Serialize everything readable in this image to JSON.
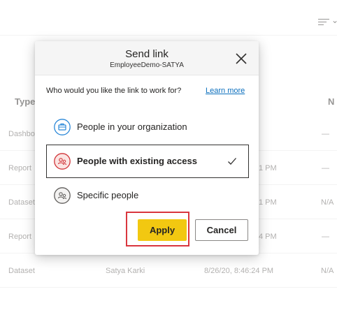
{
  "background": {
    "filter_icon": "filter-lines-icon",
    "columns": [
      "Type",
      "N"
    ],
    "rows": [
      {
        "type": "Dashbo",
        "owner": "",
        "date": "",
        "last": "—"
      },
      {
        "type": "Report",
        "owner": "",
        "date": "1 PM",
        "last": "—"
      },
      {
        "type": "Dataset",
        "owner": "",
        "date": "1 PM",
        "last": "N/A"
      },
      {
        "type": "Report",
        "owner": "",
        "date": "4 PM",
        "last": "—"
      },
      {
        "type": "Dataset",
        "owner": "Satya Karki",
        "date": "8/26/20, 8:46:24 PM",
        "last": "N/A"
      }
    ]
  },
  "dialog": {
    "title": "Send link",
    "subtitle": "EmployeeDemo-SATYA",
    "close_icon": "close-icon",
    "question": "Who would you like the link to work for?",
    "learn_more": "Learn more",
    "options": [
      {
        "label": "People in your organization",
        "icon": "organization-icon",
        "selected": false
      },
      {
        "label": "People with existing access",
        "icon": "existing-access-icon",
        "selected": true
      },
      {
        "label": "Specific people",
        "icon": "specific-people-icon",
        "selected": false
      }
    ],
    "apply_label": "Apply",
    "cancel_label": "Cancel"
  },
  "colors": {
    "accent_yellow": "#f2c811",
    "highlight_red": "#d9363e",
    "link_blue": "#0a6ebd",
    "org_icon_blue": "#2b88d8",
    "existing_icon_red": "#d13438"
  }
}
